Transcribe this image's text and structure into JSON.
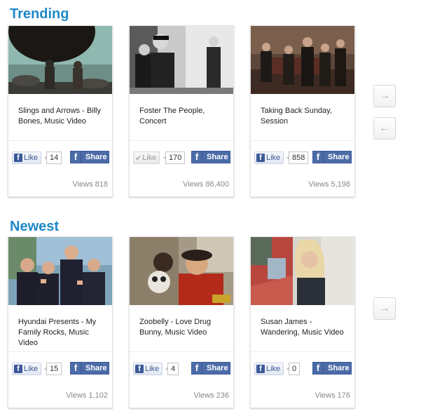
{
  "sections": [
    {
      "title": "Trending",
      "cards": [
        {
          "title": "Slings and Arrows - Billy Bones, Music Video",
          "like_label": "Like",
          "like_count": "14",
          "liked": false,
          "share_label": "Share",
          "views": "Views 818"
        },
        {
          "title": "Foster The People, Concert",
          "like_label": "Like",
          "like_count": "170",
          "liked": true,
          "share_label": "Share",
          "views": "Views 86,400"
        },
        {
          "title": "Taking Back Sunday, Session",
          "like_label": "Like",
          "like_count": "858",
          "liked": false,
          "share_label": "Share",
          "views": "Views 5,198"
        }
      ],
      "nav": {
        "next": "→",
        "prev": "←"
      }
    },
    {
      "title": "Newest",
      "cards": [
        {
          "title": "Hyundai Presents - My Family Rocks, Music Video",
          "like_label": "Like",
          "like_count": "15",
          "liked": false,
          "share_label": "Share",
          "views": "Views 1,102"
        },
        {
          "title": "Zoobelly - Love Drug Bunny, Music Video",
          "like_label": "Like",
          "like_count": "4",
          "liked": false,
          "share_label": "Share",
          "views": "Views 236"
        },
        {
          "title": "Susan James - Wandering, Music Video",
          "like_label": "Like",
          "like_count": "0",
          "liked": false,
          "share_label": "Share",
          "views": "Views 176"
        }
      ],
      "nav": {
        "next": "→"
      }
    }
  ],
  "icons": {
    "facebook": "facebook-icon",
    "check": "check-icon",
    "arrow_right": "arrow-right-icon",
    "arrow_left": "arrow-left-icon"
  },
  "colors": {
    "section_title": "#1e88c8",
    "facebook_blue": "#3b5998"
  }
}
